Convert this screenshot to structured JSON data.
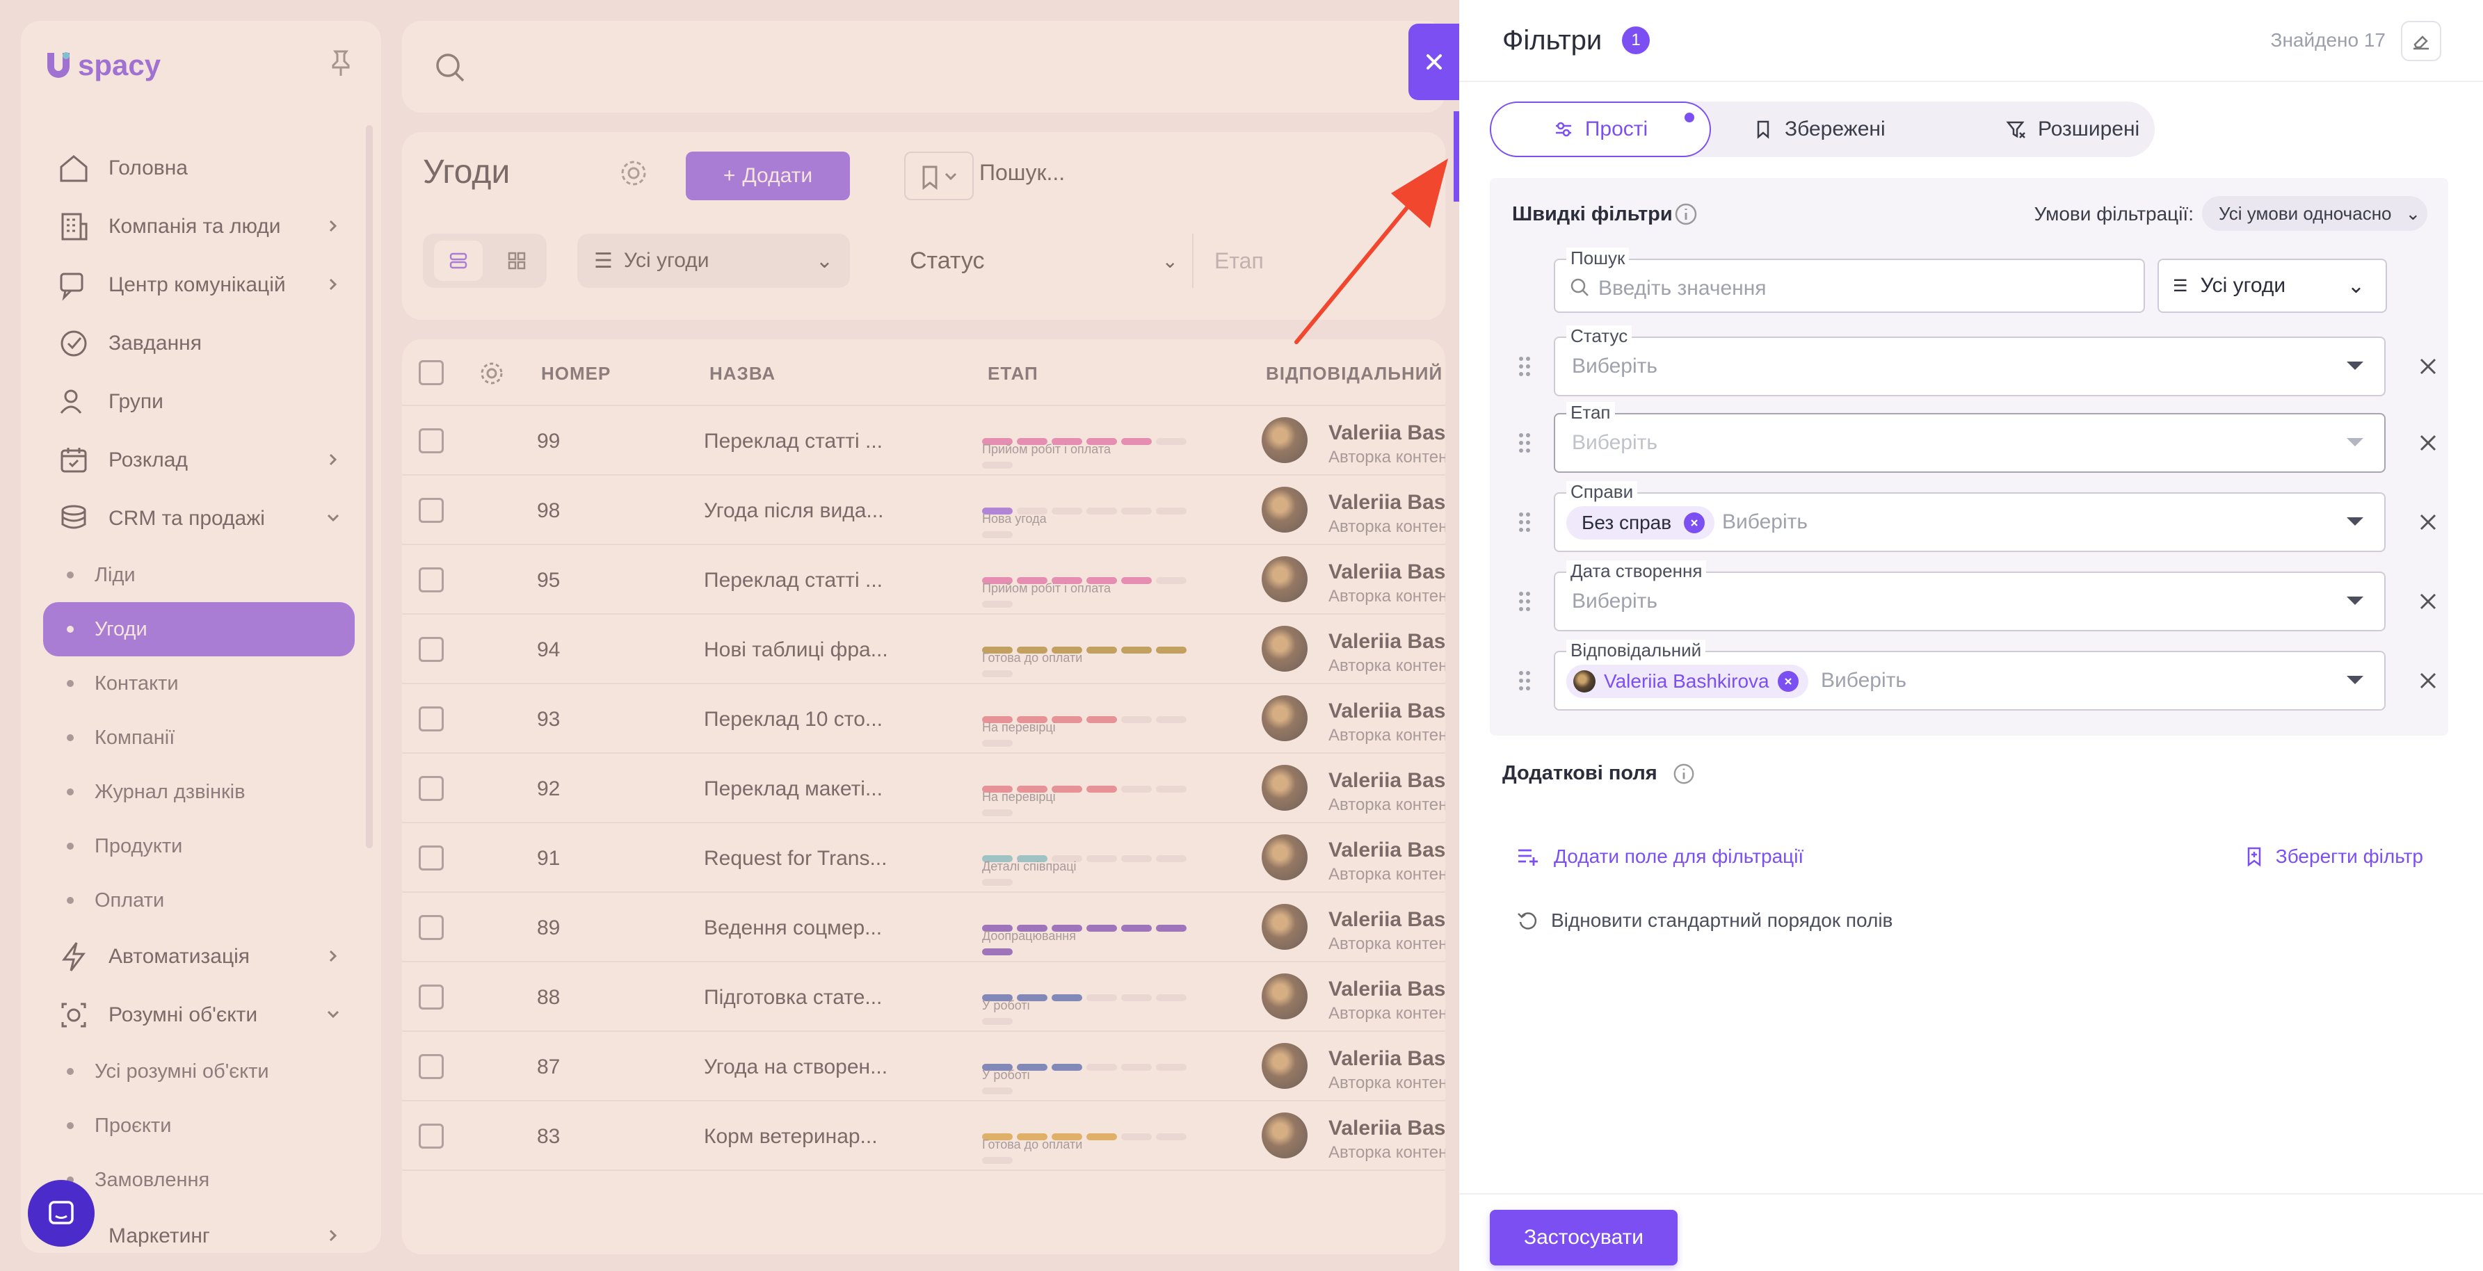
{
  "app": {
    "logo_text": "spacy",
    "nav": [
      {
        "label": "Головна",
        "icon": "home-icon",
        "chev": false
      },
      {
        "label": "Компанія та люди",
        "icon": "building-icon",
        "chev": true
      },
      {
        "label": "Центр комунікацій",
        "icon": "chat-icon",
        "chev": true
      },
      {
        "label": "Завдання",
        "icon": "check-circle-icon",
        "chev": false
      },
      {
        "label": "Групи",
        "icon": "users-icon",
        "chev": false
      },
      {
        "label": "Розклад",
        "icon": "calendar-icon",
        "chev": true
      },
      {
        "label": "CRM та продажі",
        "icon": "crm-stack-icon",
        "chev": "down"
      }
    ],
    "crm_sub": [
      "Ліди",
      "Угоди",
      "Контакти",
      "Компанії",
      "Журнал дзвінків",
      "Продукти",
      "Оплати"
    ],
    "nav2": [
      {
        "label": "Автоматизація",
        "icon": "lightning-icon",
        "chev": true
      },
      {
        "label": "Розумні об'єкти",
        "icon": "smart-object-icon",
        "chev": "down"
      }
    ],
    "smart_sub": [
      "Усі розумні об'єкти",
      "Проєкти",
      "Замовлення"
    ],
    "nav3": [
      {
        "label": "Маркетинг",
        "icon": "",
        "chev": true
      }
    ],
    "deals_title": "Угоди",
    "add_label": "Додати",
    "deal_search_placeholder": "Пошук...",
    "deals_filter": "Усі угоди",
    "status_label": "Статус",
    "stage_label": "Етап",
    "table_headers": [
      "НОМЕР",
      "НАЗВА",
      "ЕТАП",
      "ВІДПОВІДАЛЬНИЙ"
    ],
    "rows": [
      {
        "num": "99",
        "name": "Переклад статті ...",
        "stage": "Прийом робіт і оплата",
        "color": "#e56bb8",
        "filled": 5,
        "resp": "Valeriia Bashk",
        "role": "Авторка контен"
      },
      {
        "num": "98",
        "name": "Угода після вида...",
        "stage": "Нова угода",
        "color": "#8b5cf6",
        "filled": 1,
        "resp": "Valeriia Bashk",
        "role": "Авторка контен"
      },
      {
        "num": "95",
        "name": "Переклад статті ...",
        "stage": "Прийом робіт і оплата",
        "color": "#e56bb8",
        "filled": 5,
        "resp": "Valeriia Bashk",
        "role": "Авторка контен"
      },
      {
        "num": "94",
        "name": "Нові таблиці фра...",
        "stage": "Готова до оплати",
        "color": "#a88b2b",
        "filled": 6,
        "resp": "Valeriia Bashk",
        "role": "Авторка контен"
      },
      {
        "num": "93",
        "name": "Переклад 10 сто...",
        "stage": "На перевірці",
        "color": "#e5738a",
        "filled": 4,
        "resp": "Valeriia Bashk",
        "role": "Авторка контен"
      },
      {
        "num": "92",
        "name": "Переклад макеті...",
        "stage": "На перевірці",
        "color": "#e5738a",
        "filled": 4,
        "resp": "Valeriia Bashk",
        "role": "Авторка контен"
      },
      {
        "num": "91",
        "name": "Request for Trans...",
        "stage": "Деталі співпраці",
        "color": "#6cc6d8",
        "filled": 2,
        "resp": "Valeriia Bashk",
        "role": "Авторка контен"
      },
      {
        "num": "89",
        "name": "Ведення соцмер...",
        "stage": "Доопрацювання",
        "color": "#6a3fc9",
        "filled": 7,
        "resp": "Valeriia Bashk",
        "role": "Авторка контен"
      },
      {
        "num": "88",
        "name": "Підготовка стате...",
        "stage": "У роботі",
        "color": "#3a62c4",
        "filled": 3,
        "resp": "Valeriia Bashk",
        "role": "Авторка контен"
      },
      {
        "num": "87",
        "name": "Угода на створен...",
        "stage": "У роботі",
        "color": "#3a62c4",
        "filled": 3,
        "resp": "Valeriia Bashk",
        "role": "Авторка контен"
      },
      {
        "num": "83",
        "name": "Корм ветеринар...",
        "stage": "Готова до оплати",
        "color": "#d9a63a",
        "filled": 4,
        "resp": "Valeriia Bashk",
        "role": "Авторка контен"
      }
    ]
  },
  "panel": {
    "title": "Фільтри",
    "badge": "1",
    "found": "Знайдено 17",
    "tabs": [
      "Прості",
      "Збережені",
      "Розширені"
    ],
    "quick_title": "Швидкі фільтри",
    "cond_label": "Умови фільтрації:",
    "cond_value": "Усі умови одночасно",
    "search_label": "Пошук",
    "search_placeholder": "Введіть значення",
    "all_deals": "Усі угоди",
    "fields": [
      {
        "label": "Статус",
        "placeholder": "Виберіть",
        "chip": "",
        "dim": false
      },
      {
        "label": "Етап",
        "placeholder": "Виберіть",
        "chip": "",
        "dim": true
      },
      {
        "label": "Справи",
        "placeholder": "Виберіть",
        "chip": "Без справ",
        "dim": false
      },
      {
        "label": "Дата створення",
        "placeholder": "Виберіть",
        "chip": "",
        "dim": false
      },
      {
        "label": "Відповідальний",
        "placeholder": "Виберіть",
        "chip": "Valeriia Bashkirova",
        "dim": false
      }
    ],
    "extra_title": "Додаткові поля",
    "add_field": "Додати поле для фільтрації",
    "save_filter": "Зберегти фільтр",
    "restore": "Відновити стандартний порядок полів",
    "apply": "Застосувати"
  },
  "colors": {
    "accent": "#7c4ff2",
    "arrow": "#f2472f"
  }
}
